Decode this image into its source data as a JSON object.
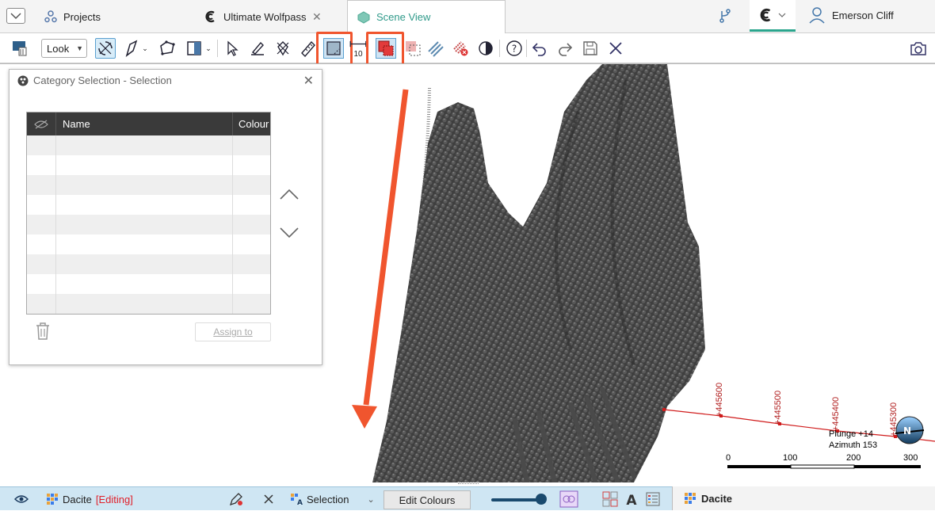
{
  "tabs": {
    "projects": "Projects",
    "ultimate": "Ultimate Wolfpass",
    "scene": "Scene View"
  },
  "user": {
    "name": "Emerson Cliff"
  },
  "toolbar": {
    "look_label": "Look",
    "tool_10_label": "10"
  },
  "dialog": {
    "title": "Category Selection - Selection",
    "columns": [
      "Name",
      "Colour"
    ],
    "assign_label": "Assign to"
  },
  "scene": {
    "coords": [
      "+445600",
      "+445500",
      "+445400",
      "+445300"
    ],
    "plunge": "Plunge +14",
    "azimuth": "Azimuth 153",
    "compass_letter": "N",
    "scale_ticks": [
      "0",
      "100",
      "200",
      "300"
    ]
  },
  "statusbar": {
    "object": "Dacite",
    "editing": "[Editing]",
    "mode": "Selection",
    "edit_colours": "Edit Colours",
    "right_object": "Dacite"
  },
  "colors": {
    "accent": "#2aa58d",
    "highlight": "#f0552e",
    "status_bg": "#cfe6f3"
  }
}
